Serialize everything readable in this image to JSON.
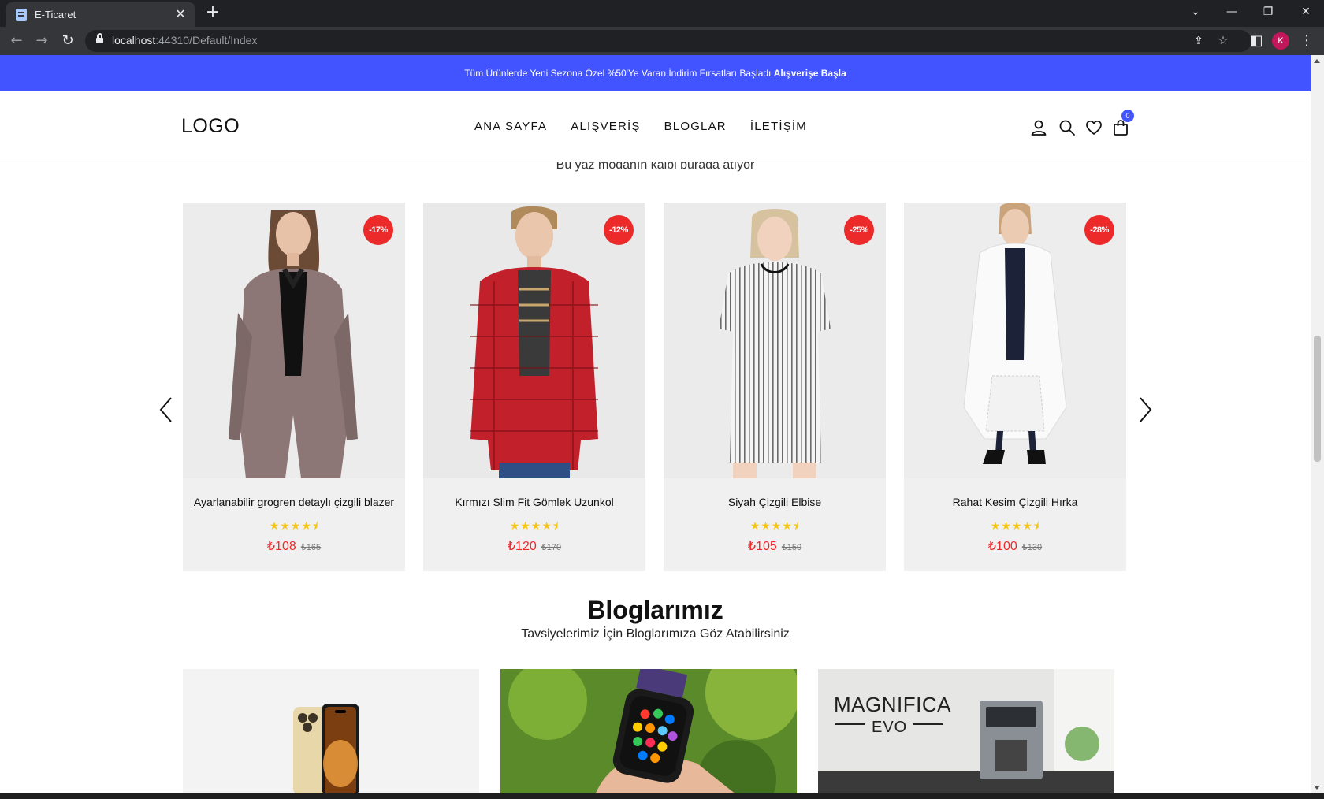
{
  "browser": {
    "tab_title": "E-Ticaret",
    "url_host": "localhost",
    "url_path": ":44310/Default/Index",
    "profile_initial": "K"
  },
  "announcement": {
    "text": "Tüm Ürünlerde Yeni Sezona Özel %50'Ye Varan İndirim Fırsatları Başladı",
    "link": "Alışverişe Başla"
  },
  "header": {
    "logo": "LOGO",
    "nav": [
      "ANA SAYFA",
      "ALIŞVERİŞ",
      "BLOGLAR",
      "İLETİŞİM"
    ],
    "cart_count": "0"
  },
  "products_section": {
    "subtitle": "Bu yaz modanın kalbi burada atıyor"
  },
  "products": [
    {
      "name": "Ayarlanabilir grogren detaylı çizgili blazer",
      "discount": "-17%",
      "price": "₺108",
      "old_price": "₺165",
      "rating": 4.5
    },
    {
      "name": "Kırmızı Slim Fit Gömlek Uzunkol",
      "discount": "-12%",
      "price": "₺120",
      "old_price": "₺170",
      "rating": 4.5
    },
    {
      "name": "Siyah Çizgili Elbise",
      "discount": "-25%",
      "price": "₺105",
      "old_price": "₺150",
      "rating": 4.5
    },
    {
      "name": "Rahat Kesim Çizgili Hırka",
      "discount": "-28%",
      "price": "₺100",
      "old_price": "₺130",
      "rating": 4.5
    }
  ],
  "stars_display": "★★★★⯨",
  "blogs": {
    "title": "Bloglarımız",
    "subtitle": "Tavsiyelerimiz İçin Bloglarımıza Göz Atabilirsiniz",
    "magnifica_line1": "MAGNIFICA",
    "magnifica_line2": "EVO"
  },
  "colors": {
    "accent": "#4254ff",
    "discount": "#ed2a2a",
    "star": "#f5c518"
  }
}
